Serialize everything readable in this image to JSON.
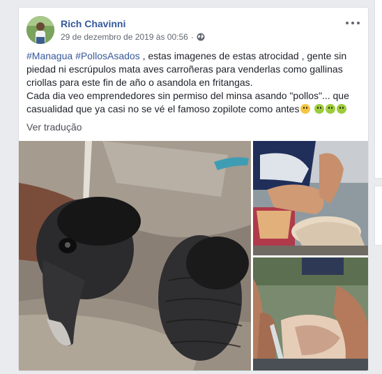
{
  "post": {
    "author": "Rich Chavinni",
    "timestamp": "29 de dezembro de 2019 às 00:56",
    "separator": "·",
    "privacy_icon": "globe-icon",
    "hashtags": [
      "#Managua",
      "#PollosAsados"
    ],
    "text_line1_rest": " , estas imagenes de estas atrocidad , gente sin piedad ni escrúpulos mata aves carroñeras para venderlas como gallinas criollas para este fin de año o asandola en fritangas.",
    "text_line2": "Cada dia veo emprendedores sin permiso del minsa asando \"pollos\"... que casualidad que ya casi no se vé el famoso zopilote como antes",
    "emojis": [
      "thinking-face-emoji",
      "nauseated-face-emoji",
      "nauseated-face-emoji",
      "nauseated-face-emoji"
    ],
    "see_translation": "Ver tradução",
    "options_icon": "more-options-icon"
  },
  "photos": [
    {
      "name": "vulture-heads-photo"
    },
    {
      "name": "plucking-bird-photo"
    },
    {
      "name": "cleaning-carcass-photo"
    }
  ],
  "colors": {
    "link": "#365899",
    "text": "#1d2129",
    "meta": "#616770",
    "background": "#e9ebee"
  }
}
